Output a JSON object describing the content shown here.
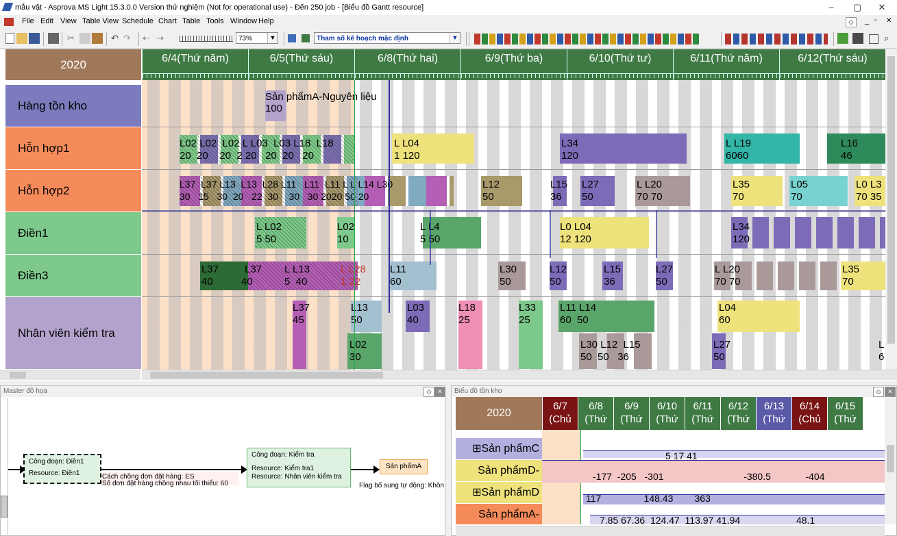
{
  "window": {
    "title": "mẫu vật - Asprova MS Light 15.3.0.0 Version thử nghiệm (Not for operational use) - Đến 250 job  - [Biểu đồ Gantt resource]",
    "minimize": "–",
    "maximize": "▢",
    "close": "✕"
  },
  "menu": [
    "File",
    "Edit",
    "View",
    "Table View",
    "Schedule",
    "Chart",
    "Table",
    "Tools",
    "Window",
    "Help"
  ],
  "toolbar": {
    "zoom": "73%",
    "plan_param": "Tham số kế hoạch mặc định"
  },
  "gantt": {
    "year": "2020",
    "dates": [
      "6/4(Thứ năm)",
      "6/5(Thứ sáu)",
      "6/8(Thứ hai)",
      "6/9(Thứ ba)",
      "6/10(Thứ tư)",
      "6/11(Thứ năm)",
      "6/12(Thứ sáu)"
    ],
    "resources": [
      {
        "name": "Hàng tồn kho",
        "color": "#7b7bbd"
      },
      {
        "name": "Hỗn hợp1",
        "color": "#f58b5a"
      },
      {
        "name": "Hỗn hợp2",
        "color": "#f58b5a"
      },
      {
        "name": "Điền1",
        "color": "#7dc98b"
      },
      {
        "name": "Điền3",
        "color": "#7dc98b"
      },
      {
        "name": "Nhân viên kiểm tra",
        "color": "#b3a3cc"
      }
    ],
    "inventory_label": "Sản phẩmA-Nguyên liệu\n100",
    "bars": {
      "r1": [
        "L02 L02  L02 L L03  L03 L18  L18",
        "20  20    20  2 20   20  20   20",
        "L L04",
        "1 120",
        "L34",
        "120",
        "L L19",
        "6060",
        "L16",
        "46"
      ],
      "r2": [
        "L37  L37 L13  L13  L28 L11   L11  L11 L L L14 L30",
        "30   15   30  20   22  30    30   30 2020 50 20",
        "L12",
        "50",
        "L15",
        "36",
        "L27",
        "50",
        "L L20",
        "70 70",
        "L35",
        "70",
        "L05",
        "70",
        "L0 L3",
        "70 35"
      ],
      "r3": [
        "L L02",
        "5 50",
        "L02",
        "10",
        "L L4",
        "5 50",
        "L0 L04",
        "12 120",
        "L34",
        "120"
      ],
      "r4": [
        "L37",
        "40",
        "L37",
        "40",
        "L L13",
        "5  40",
        "L L28",
        "1 22",
        "L11",
        "60",
        "L30",
        "50",
        "L12",
        "50",
        "L15",
        "36",
        "L27",
        "50",
        "L L20",
        "70 70",
        "L35",
        "70"
      ],
      "r5": [
        "L37",
        "45",
        "L13",
        "50",
        "L03",
        "40",
        "L18",
        "25",
        "L33",
        "25",
        "L11 L14",
        "60  50",
        "L02",
        "30",
        "L30 L12  L15",
        "50  50   36",
        "L04",
        "60",
        "L27",
        "50",
        "L",
        "6"
      ]
    }
  },
  "master": {
    "title": "Master đồ họa",
    "node1": {
      "line1": "Công đoạn: Điền1",
      "line2": "Resource: Điền1"
    },
    "node2": {
      "line1": "Công đoạn: Kiểm tra",
      "line2": "Resource: Kiểm tra1",
      "line3": "Resource: Nhân viên kiểm tra"
    },
    "node3": "Sản phẩmA",
    "edge_note1": "Cách chồng đơn đặt hàng: ES",
    "edge_note2": "Số đơn đặt hàng chồng nhau tối thiểu: 60",
    "edge_note3": "Flag bổ sung tự động: Khôn"
  },
  "inventory": {
    "title": "Biểu đồ tồn kho",
    "year": "2020",
    "dates": [
      {
        "d": "6/7",
        "w": "(Chủ",
        "color": "#7a1414"
      },
      {
        "d": "6/8",
        "w": "(Thứ",
        "color": "#3f7a45"
      },
      {
        "d": "6/9",
        "w": "(Thứ",
        "color": "#3f7a45"
      },
      {
        "d": "6/10",
        "w": "(Thứ",
        "color": "#3f7a45"
      },
      {
        "d": "6/11",
        "w": "(Thứ",
        "color": "#3f7a45"
      },
      {
        "d": "6/12",
        "w": "(Thứ",
        "color": "#3f7a45"
      },
      {
        "d": "6/13",
        "w": "(Thứ",
        "color": "#5a5aa8"
      },
      {
        "d": "6/14",
        "w": "(Chủ",
        "color": "#7a1414"
      },
      {
        "d": "6/15",
        "w": "(Thứ",
        "color": "#3f7a45"
      }
    ],
    "rows": [
      {
        "name": "⊞Sản phẩmC",
        "color": "#b3b0e0",
        "values": "5 17 41"
      },
      {
        "name": "Sản phẩmD-",
        "color": "#eee27c",
        "values": "-177  -205   -301                              -380.5             -404"
      },
      {
        "name": "⊞Sản phẩmD",
        "color": "#eee27c",
        "values": "117                148.43        363"
      },
      {
        "name": "Sản phẩmA-",
        "color": "#f58b5a",
        "values": "7.85 67.36  124.47  113.97 41.94                     48.1"
      }
    ]
  }
}
